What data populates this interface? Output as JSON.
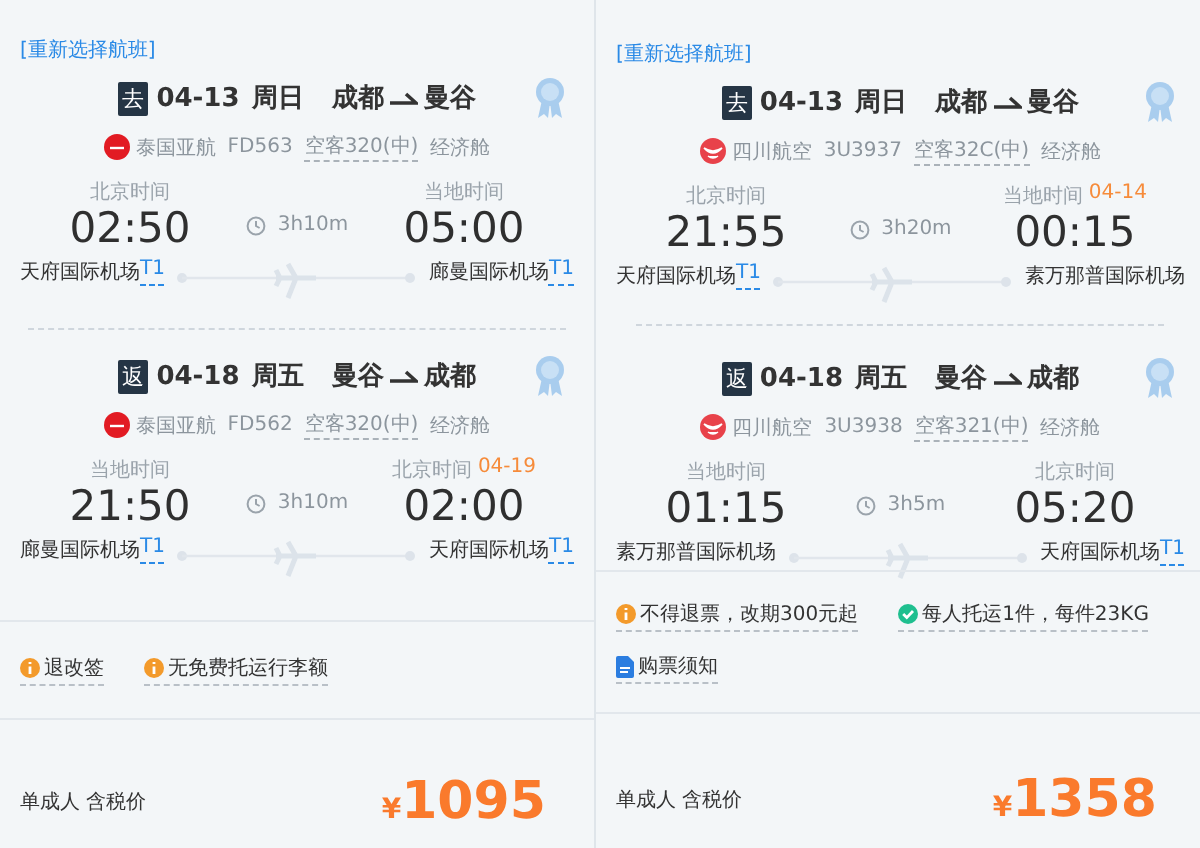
{
  "cards": [
    {
      "reselect": "[重新选择航班]",
      "legs": [
        {
          "tag": "去",
          "date": "04-13",
          "weekday": "周日",
          "from": "成都",
          "to": "曼谷",
          "logo": {
            "kind": "circle"
          },
          "airline": "泰国亚航",
          "flight": "FD563",
          "aircraft": "空客320(中)",
          "cabin": "经济舱",
          "dep": {
            "label": "北京时间",
            "time": "02:50",
            "airport": "天府国际机场",
            "terminal": "T1"
          },
          "duration": "3h10m",
          "arr": {
            "label": "当地时间",
            "time": "05:00",
            "airport": "廊曼国际机场",
            "terminal": "T1"
          }
        },
        {
          "tag": "返",
          "date": "04-18",
          "weekday": "周五",
          "from": "曼谷",
          "to": "成都",
          "logo": {
            "kind": "circle"
          },
          "airline": "泰国亚航",
          "flight": "FD562",
          "aircraft": "空客320(中)",
          "cabin": "经济舱",
          "dep": {
            "label": "当地时间",
            "time": "21:50",
            "airport": "廊曼国际机场",
            "terminal": "T1"
          },
          "duration": "3h10m",
          "arr": {
            "label": "北京时间",
            "next_day": "04-19",
            "time": "02:00",
            "airport": "天府国际机场",
            "terminal": "T1"
          }
        }
      ],
      "notes": [
        {
          "kind": "info",
          "text": "退改签"
        },
        {
          "kind": "info",
          "text": "无免费托运行李额"
        }
      ],
      "price_label": "单成人 含税价",
      "currency": "¥",
      "price": "1095"
    },
    {
      "reselect": "[重新选择航班]",
      "legs": [
        {
          "tag": "去",
          "date": "04-13",
          "weekday": "周日",
          "from": "成都",
          "to": "曼谷",
          "logo": {
            "kind": "bird"
          },
          "airline": "四川航空",
          "flight": "3U3937",
          "aircraft": "空客32C(中)",
          "cabin": "经济舱",
          "dep": {
            "label": "北京时间",
            "time": "21:55",
            "airport": "天府国际机场",
            "terminal": "T1"
          },
          "duration": "3h20m",
          "arr": {
            "label": "当地时间",
            "next_day": "04-14",
            "time": "00:15",
            "airport": "素万那普国际机场"
          }
        },
        {
          "tag": "返",
          "date": "04-18",
          "weekday": "周五",
          "from": "曼谷",
          "to": "成都",
          "logo": {
            "kind": "bird"
          },
          "airline": "四川航空",
          "flight": "3U3938",
          "aircraft": "空客321(中)",
          "cabin": "经济舱",
          "dep": {
            "label": "当地时间",
            "time": "01:15",
            "airport": "素万那普国际机场"
          },
          "duration": "3h5m",
          "arr": {
            "label": "北京时间",
            "time": "05:20",
            "airport": "天府国际机场",
            "terminal": "T1"
          }
        }
      ],
      "notes": [
        {
          "kind": "info",
          "text": "不得退票，改期300元起"
        },
        {
          "kind": "check",
          "text": "每人托运1件，每件23KG"
        },
        {
          "kind": "doc",
          "text": "购票须知"
        }
      ],
      "price_label": "单成人 含税价",
      "currency": "¥",
      "price": "1358"
    }
  ]
}
